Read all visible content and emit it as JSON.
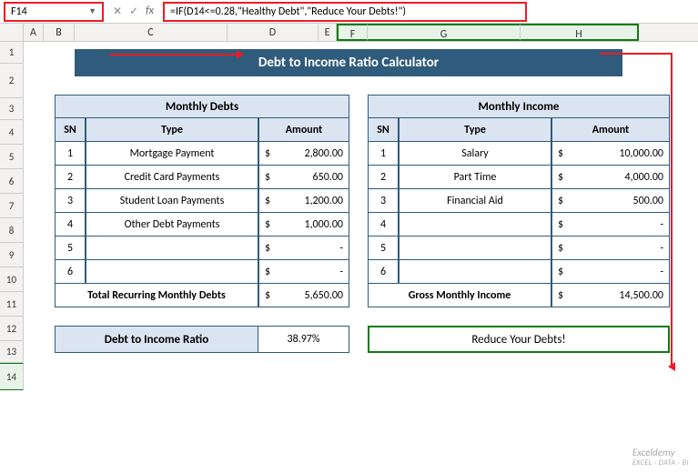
{
  "name_box": "F14",
  "formula": "=IF(D14<=0.28,\"Healthy Debt\",\"Reduce Your Debts!\")",
  "columns": [
    "A",
    "B",
    "C",
    "D",
    "E",
    "F",
    "G",
    "H"
  ],
  "rows": [
    "1",
    "2",
    "3",
    "4",
    "5",
    "6",
    "7",
    "8",
    "9",
    "10",
    "11",
    "12",
    "13",
    "14"
  ],
  "title": "Debt to Income Ratio Calculator",
  "debts": {
    "header": "Monthly Debts",
    "cols": {
      "sn": "SN",
      "type": "Type",
      "amount": "Amount"
    },
    "rows": [
      {
        "sn": "1",
        "type": "Mortgage Payment",
        "amount": "2,800.00"
      },
      {
        "sn": "2",
        "type": "Credit Card Payments",
        "amount": "650.00"
      },
      {
        "sn": "3",
        "type": "Student Loan Payments",
        "amount": "1,200.00"
      },
      {
        "sn": "4",
        "type": "Other Debt Payments",
        "amount": "1,000.00"
      },
      {
        "sn": "5",
        "type": "",
        "amount": "-"
      },
      {
        "sn": "6",
        "type": "",
        "amount": "-"
      }
    ],
    "total_label": "Total Recurring Monthly Debts",
    "total": "5,650.00"
  },
  "income": {
    "header": "Monthly Income",
    "cols": {
      "sn": "SN",
      "type": "Type",
      "amount": "Amount"
    },
    "rows": [
      {
        "sn": "1",
        "type": "Salary",
        "amount": "10,000.00"
      },
      {
        "sn": "2",
        "type": "Part Time",
        "amount": "4,000.00"
      },
      {
        "sn": "3",
        "type": "Financial Aid",
        "amount": "500.00"
      },
      {
        "sn": "4",
        "type": "",
        "amount": "-"
      },
      {
        "sn": "5",
        "type": "",
        "amount": "-"
      },
      {
        "sn": "6",
        "type": "",
        "amount": "-"
      }
    ],
    "total_label": "Gross Monthly Income",
    "total": "14,500.00"
  },
  "ratio": {
    "label": "Debt to Income Ratio",
    "value": "38.97%"
  },
  "result": "Reduce Your Debts!",
  "currency": "$",
  "watermark": {
    "main": "Exceldemy",
    "sub": "EXCEL · DATA · BI"
  }
}
